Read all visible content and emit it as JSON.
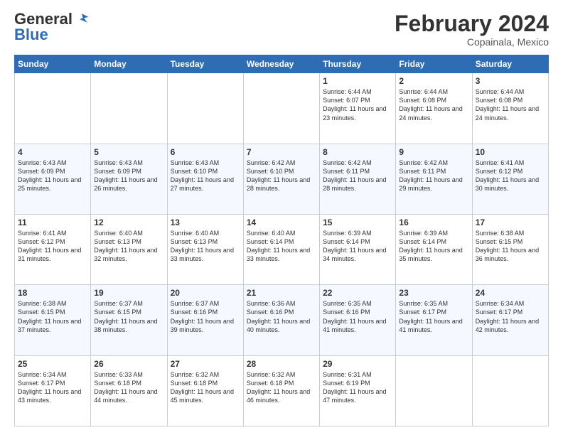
{
  "logo": {
    "general": "General",
    "blue": "Blue"
  },
  "title": "February 2024",
  "subtitle": "Copainala, Mexico",
  "days_of_week": [
    "Sunday",
    "Monday",
    "Tuesday",
    "Wednesday",
    "Thursday",
    "Friday",
    "Saturday"
  ],
  "weeks": [
    [
      {
        "day": "",
        "info": ""
      },
      {
        "day": "",
        "info": ""
      },
      {
        "day": "",
        "info": ""
      },
      {
        "day": "",
        "info": ""
      },
      {
        "day": "1",
        "info": "Sunrise: 6:44 AM\nSunset: 6:07 PM\nDaylight: 11 hours and 23 minutes."
      },
      {
        "day": "2",
        "info": "Sunrise: 6:44 AM\nSunset: 6:08 PM\nDaylight: 11 hours and 24 minutes."
      },
      {
        "day": "3",
        "info": "Sunrise: 6:44 AM\nSunset: 6:08 PM\nDaylight: 11 hours and 24 minutes."
      }
    ],
    [
      {
        "day": "4",
        "info": "Sunrise: 6:43 AM\nSunset: 6:09 PM\nDaylight: 11 hours and 25 minutes."
      },
      {
        "day": "5",
        "info": "Sunrise: 6:43 AM\nSunset: 6:09 PM\nDaylight: 11 hours and 26 minutes."
      },
      {
        "day": "6",
        "info": "Sunrise: 6:43 AM\nSunset: 6:10 PM\nDaylight: 11 hours and 27 minutes."
      },
      {
        "day": "7",
        "info": "Sunrise: 6:42 AM\nSunset: 6:10 PM\nDaylight: 11 hours and 28 minutes."
      },
      {
        "day": "8",
        "info": "Sunrise: 6:42 AM\nSunset: 6:11 PM\nDaylight: 11 hours and 28 minutes."
      },
      {
        "day": "9",
        "info": "Sunrise: 6:42 AM\nSunset: 6:11 PM\nDaylight: 11 hours and 29 minutes."
      },
      {
        "day": "10",
        "info": "Sunrise: 6:41 AM\nSunset: 6:12 PM\nDaylight: 11 hours and 30 minutes."
      }
    ],
    [
      {
        "day": "11",
        "info": "Sunrise: 6:41 AM\nSunset: 6:12 PM\nDaylight: 11 hours and 31 minutes."
      },
      {
        "day": "12",
        "info": "Sunrise: 6:40 AM\nSunset: 6:13 PM\nDaylight: 11 hours and 32 minutes."
      },
      {
        "day": "13",
        "info": "Sunrise: 6:40 AM\nSunset: 6:13 PM\nDaylight: 11 hours and 33 minutes."
      },
      {
        "day": "14",
        "info": "Sunrise: 6:40 AM\nSunset: 6:14 PM\nDaylight: 11 hours and 33 minutes."
      },
      {
        "day": "15",
        "info": "Sunrise: 6:39 AM\nSunset: 6:14 PM\nDaylight: 11 hours and 34 minutes."
      },
      {
        "day": "16",
        "info": "Sunrise: 6:39 AM\nSunset: 6:14 PM\nDaylight: 11 hours and 35 minutes."
      },
      {
        "day": "17",
        "info": "Sunrise: 6:38 AM\nSunset: 6:15 PM\nDaylight: 11 hours and 36 minutes."
      }
    ],
    [
      {
        "day": "18",
        "info": "Sunrise: 6:38 AM\nSunset: 6:15 PM\nDaylight: 11 hours and 37 minutes."
      },
      {
        "day": "19",
        "info": "Sunrise: 6:37 AM\nSunset: 6:15 PM\nDaylight: 11 hours and 38 minutes."
      },
      {
        "day": "20",
        "info": "Sunrise: 6:37 AM\nSunset: 6:16 PM\nDaylight: 11 hours and 39 minutes."
      },
      {
        "day": "21",
        "info": "Sunrise: 6:36 AM\nSunset: 6:16 PM\nDaylight: 11 hours and 40 minutes."
      },
      {
        "day": "22",
        "info": "Sunrise: 6:35 AM\nSunset: 6:16 PM\nDaylight: 11 hours and 41 minutes."
      },
      {
        "day": "23",
        "info": "Sunrise: 6:35 AM\nSunset: 6:17 PM\nDaylight: 11 hours and 41 minutes."
      },
      {
        "day": "24",
        "info": "Sunrise: 6:34 AM\nSunset: 6:17 PM\nDaylight: 11 hours and 42 minutes."
      }
    ],
    [
      {
        "day": "25",
        "info": "Sunrise: 6:34 AM\nSunset: 6:17 PM\nDaylight: 11 hours and 43 minutes."
      },
      {
        "day": "26",
        "info": "Sunrise: 6:33 AM\nSunset: 6:18 PM\nDaylight: 11 hours and 44 minutes."
      },
      {
        "day": "27",
        "info": "Sunrise: 6:32 AM\nSunset: 6:18 PM\nDaylight: 11 hours and 45 minutes."
      },
      {
        "day": "28",
        "info": "Sunrise: 6:32 AM\nSunset: 6:18 PM\nDaylight: 11 hours and 46 minutes."
      },
      {
        "day": "29",
        "info": "Sunrise: 6:31 AM\nSunset: 6:19 PM\nDaylight: 11 hours and 47 minutes."
      },
      {
        "day": "",
        "info": ""
      },
      {
        "day": "",
        "info": ""
      }
    ]
  ]
}
